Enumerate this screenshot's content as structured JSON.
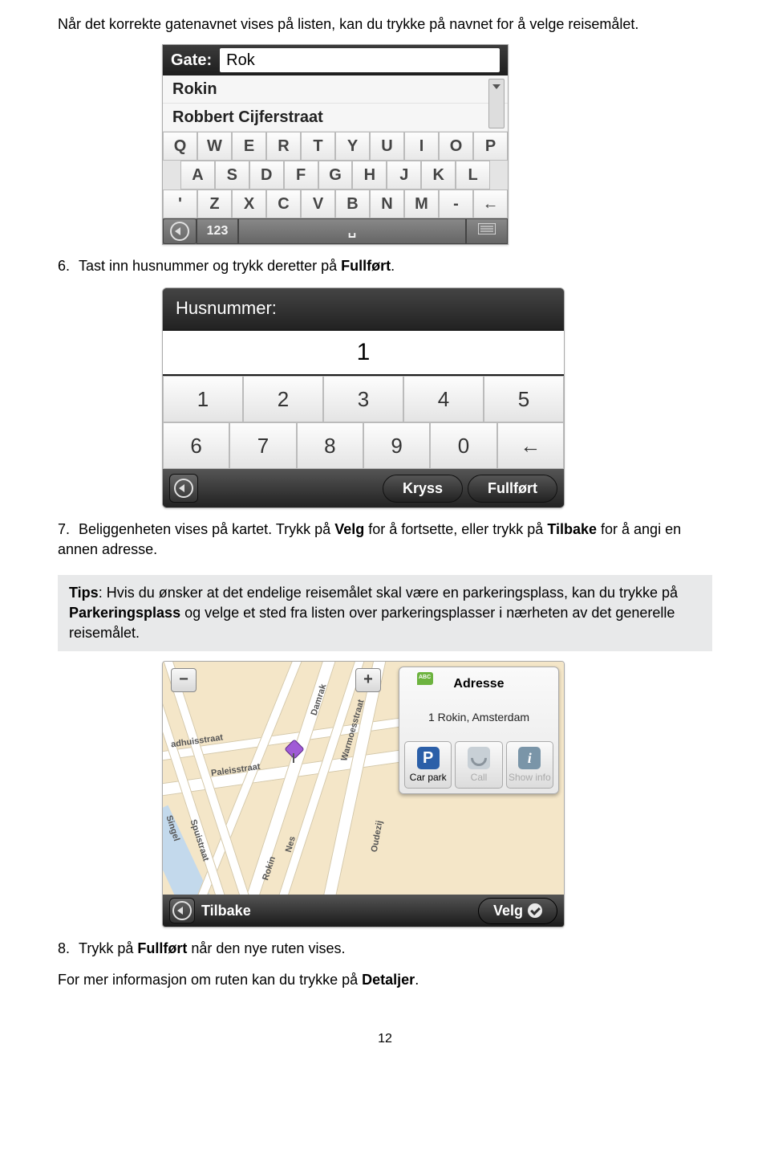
{
  "intro": "Når det korrekte gatenavnet vises på listen, kan du trykke på navnet for å velge reisemålet.",
  "step6": {
    "num": "6.",
    "text_before": "Tast inn husnummer og trykk deretter på ",
    "bold": "Fullført",
    "text_after": "."
  },
  "step7": {
    "num": "7.",
    "text1": "Beliggenheten vises på kartet. Trykk på ",
    "bold1": "Velg",
    "text2": " for å fortsette, eller trykk på ",
    "bold2": "Tilbake",
    "text3": " for å angi en annen adresse."
  },
  "tip": {
    "label": "Tips",
    "text1": ": Hvis du ønsker at det endelige reisemålet skal være en parkeringsplass, kan du trykke på ",
    "bold": "Parkeringsplass",
    "text2": " og velge et sted fra listen over parkeringsplasser i nærheten av det generelle reisemålet."
  },
  "step8": {
    "num": "8.",
    "text1": "Trykk på ",
    "bold": "Fullført",
    "text2": " når den nye ruten vises."
  },
  "final": {
    "text1": "For mer informasjon om ruten kan du trykke på ",
    "bold": "Detaljer",
    "text2": "."
  },
  "page_number": "12",
  "shot1": {
    "label": "Gate:",
    "input": "Rok",
    "suggestions": [
      "Rokin",
      "Robbert Cijferstraat"
    ],
    "row1": [
      "Q",
      "W",
      "E",
      "R",
      "T",
      "Y",
      "U",
      "I",
      "O",
      "P"
    ],
    "row2": [
      "A",
      "S",
      "D",
      "F",
      "G",
      "H",
      "J",
      "K",
      "L"
    ],
    "row3": [
      "'",
      "Z",
      "X",
      "C",
      "V",
      "B",
      "N",
      "M",
      "-",
      "←"
    ],
    "numkey": "123",
    "space": "␣"
  },
  "shot2": {
    "label": "Husnummer:",
    "value": "1",
    "row1": [
      "1",
      "2",
      "3",
      "4",
      "5"
    ],
    "row2": [
      "6",
      "7",
      "8",
      "9",
      "0",
      "←"
    ],
    "btn_cross": "Kryss",
    "btn_done": "Fullført"
  },
  "shot3": {
    "panel_title": "Adresse",
    "panel_sub": "1 Rokin, Amsterdam",
    "btn_park": "Car park",
    "btn_call": "Call",
    "btn_info": "Show info",
    "back": "Tilbake",
    "select": "Velg",
    "streets": {
      "damrak": "Damrak",
      "warmoes": "Warmoesstraat",
      "paleis": "Paleisstraat",
      "adhuis": "adhuisstraat",
      "nes": "Nes",
      "rokin": "Rokin",
      "singel": "Singel",
      "spui": "Spuistraat",
      "oudezij": "Oudezij"
    }
  }
}
